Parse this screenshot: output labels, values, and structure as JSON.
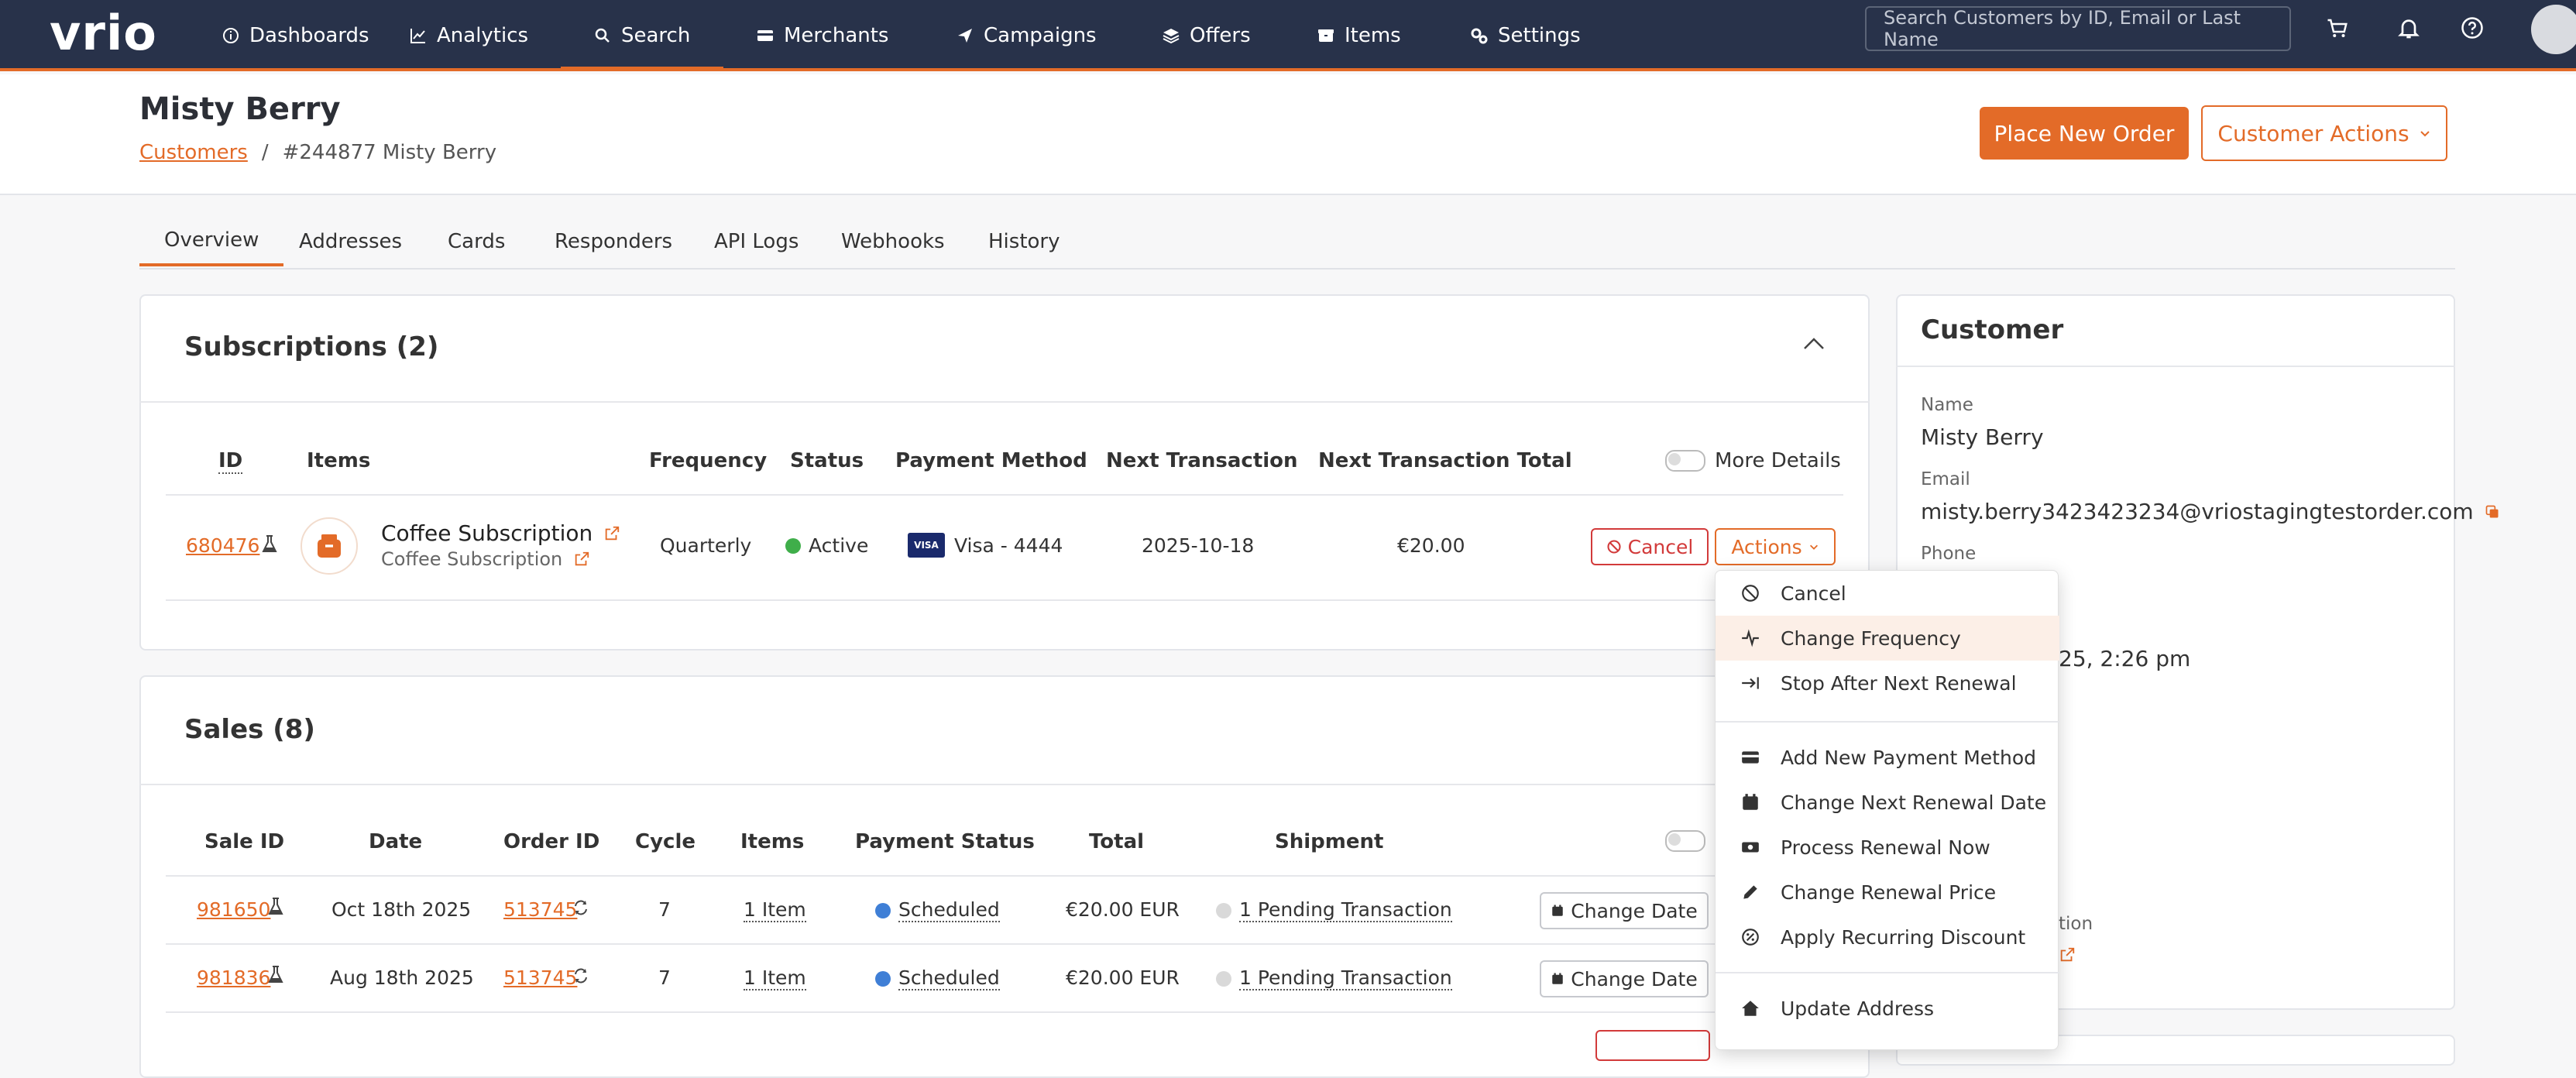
{
  "brand": {
    "logo_text": "vrio",
    "accent": "#e36b28",
    "nav_bg": "#28324a"
  },
  "nav": {
    "items": [
      {
        "label": "Dashboards",
        "icon": "info-circle-icon"
      },
      {
        "label": "Analytics",
        "icon": "chart-line-icon"
      },
      {
        "label": "Search",
        "icon": "search-icon"
      },
      {
        "label": "Merchants",
        "icon": "credit-card-icon"
      },
      {
        "label": "Campaigns",
        "icon": "send-icon"
      },
      {
        "label": "Offers",
        "icon": "layers-icon"
      },
      {
        "label": "Items",
        "icon": "box-icon"
      },
      {
        "label": "Settings",
        "icon": "gears-icon"
      }
    ],
    "active": "Search",
    "search_placeholder": "Search Customers by ID, Email or Last Name"
  },
  "header": {
    "title": "Misty Berry",
    "breadcrumb_link": "Customers",
    "breadcrumb_sep": "/",
    "breadcrumb_current": "#244877 Misty Berry",
    "place_order": "Place New Order",
    "customer_actions": "Customer Actions"
  },
  "tabs": [
    "Overview",
    "Addresses",
    "Cards",
    "Responders",
    "API Logs",
    "Webhooks",
    "History"
  ],
  "subscriptions": {
    "title": "Subscriptions (2)",
    "headers": {
      "id": "ID",
      "items": "Items",
      "frequency": "Frequency",
      "status": "Status",
      "payment": "Payment Method",
      "next": "Next Transaction",
      "total": "Next Transaction Total"
    },
    "more_details": "More Details",
    "row": {
      "id": "680476",
      "item_name": "Coffee Subscription",
      "item_sub": "Coffee Subscription",
      "frequency": "Quarterly",
      "status": "Active",
      "card_brand": "VISA",
      "payment": "Visa - 4444",
      "next": "2025-10-18",
      "total": "€20.00",
      "cancel": "Cancel",
      "actions": "Actions"
    }
  },
  "sales": {
    "title": "Sales (8)",
    "headers": {
      "sale_id": "Sale ID",
      "date": "Date",
      "order_id": "Order ID",
      "cycle": "Cycle",
      "items": "Items",
      "pay_status": "Payment Status",
      "total": "Total",
      "shipment": "Shipment"
    },
    "rows": [
      {
        "sale_id": "981650",
        "date": "Oct 18th 2025",
        "order_id": "513745",
        "cycle": "7",
        "items": "1 Item",
        "pay_status": "Scheduled",
        "total": "€20.00 EUR",
        "shipment": "1 Pending Transaction",
        "action": "Change Date"
      },
      {
        "sale_id": "981836",
        "date": "Aug 18th 2025",
        "order_id": "513745",
        "cycle": "7",
        "items": "1 Item",
        "pay_status": "Scheduled",
        "total": "€20.00 EUR",
        "shipment": "1 Pending Transaction",
        "action": "Change Date"
      }
    ]
  },
  "customer": {
    "title": "Customer",
    "name_label": "Name",
    "name": "Misty Berry",
    "email_label": "Email",
    "email": "misty.berry3423423234@vriostagingtestorder.com",
    "phone_label": "Phone",
    "partial_date": "25, 2:26 pm",
    "partial_label": "tion"
  },
  "menu": {
    "items": [
      {
        "label": "Cancel",
        "icon": "ban-icon"
      },
      {
        "label": "Change Frequency",
        "icon": "wave-icon"
      },
      {
        "label": "Stop After Next Renewal",
        "icon": "arrow-to-line-icon"
      },
      {
        "label": "Add New Payment Method",
        "icon": "credit-card-icon"
      },
      {
        "label": "Change Next Renewal Date",
        "icon": "calendar-icon"
      },
      {
        "label": "Process Renewal Now",
        "icon": "money-icon"
      },
      {
        "label": "Change Renewal Price",
        "icon": "pencil-icon"
      },
      {
        "label": "Apply Recurring Discount",
        "icon": "percent-badge-icon"
      },
      {
        "label": "Update Address",
        "icon": "home-icon"
      }
    ]
  }
}
